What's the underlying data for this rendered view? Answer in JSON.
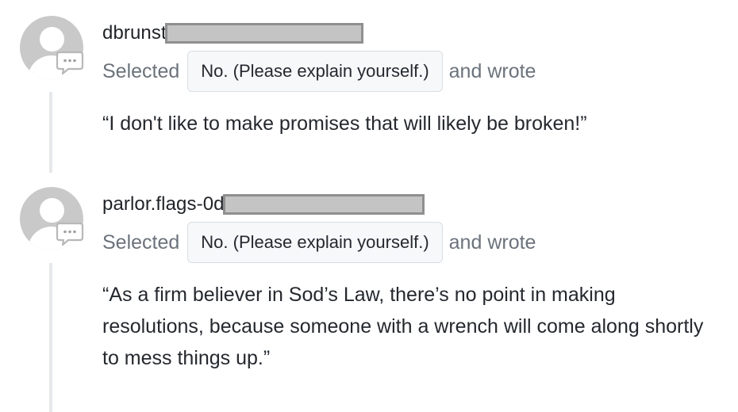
{
  "comments": [
    {
      "username": "dbrunst",
      "selected_prefix": "Selected",
      "choice": "No. (Please explain yourself.)",
      "wrote_suffix": "and wrote",
      "text": "“I don't like to make promises that will likely be broken!”"
    },
    {
      "username": "parlor.flags-0d",
      "selected_prefix": "Selected",
      "choice": "No. (Please explain yourself.)",
      "wrote_suffix": "and wrote",
      "text": "“As a firm believer in Sod’s Law, there’s no point in making resolutions, because someone with a wrench will come along shortly to mess things up.”"
    }
  ],
  "icons": {
    "avatar": "default-avatar-icon",
    "badge": "comment-bubble-icon"
  },
  "colors": {
    "avatar_gray": "#c9c9c9",
    "thread_line": "#e6e8eb",
    "muted_text": "#6a737d",
    "pill_bg": "#f6f8fa",
    "redaction_fill": "#c4c4c4",
    "redaction_border": "#8f8f8f"
  }
}
